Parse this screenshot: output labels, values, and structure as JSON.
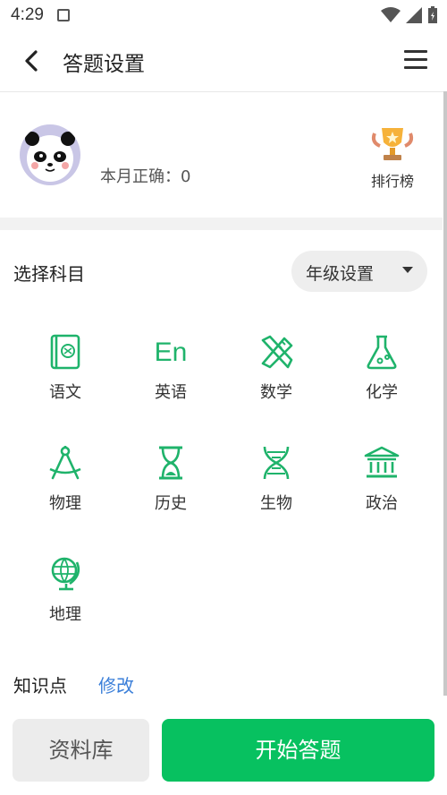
{
  "status": {
    "time": "4:29"
  },
  "appbar": {
    "title": "答题设置"
  },
  "profile": {
    "month_correct": "本月正确：0",
    "rank_label": "排行榜"
  },
  "subjects_section": {
    "title": "选择科目",
    "grade_button": "年级设置"
  },
  "subjects": [
    {
      "label": "语文",
      "icon": "book-icon"
    },
    {
      "label": "英语",
      "icon": "en-text-icon",
      "icon_text": "En"
    },
    {
      "label": "数学",
      "icon": "ruler-pencil-icon"
    },
    {
      "label": "化学",
      "icon": "flask-icon"
    },
    {
      "label": "物理",
      "icon": "compass-icon"
    },
    {
      "label": "历史",
      "icon": "hourglass-icon"
    },
    {
      "label": "生物",
      "icon": "dna-icon"
    },
    {
      "label": "政治",
      "icon": "institution-icon"
    },
    {
      "label": "地理",
      "icon": "globe-icon"
    }
  ],
  "knowledge": {
    "label": "知识点",
    "edit": "修改"
  },
  "bottom": {
    "library": "资料库",
    "start": "开始答题"
  },
  "colors": {
    "accent": "#07c160",
    "link": "#3b7fd9",
    "icon_green": "#1fb36b"
  }
}
